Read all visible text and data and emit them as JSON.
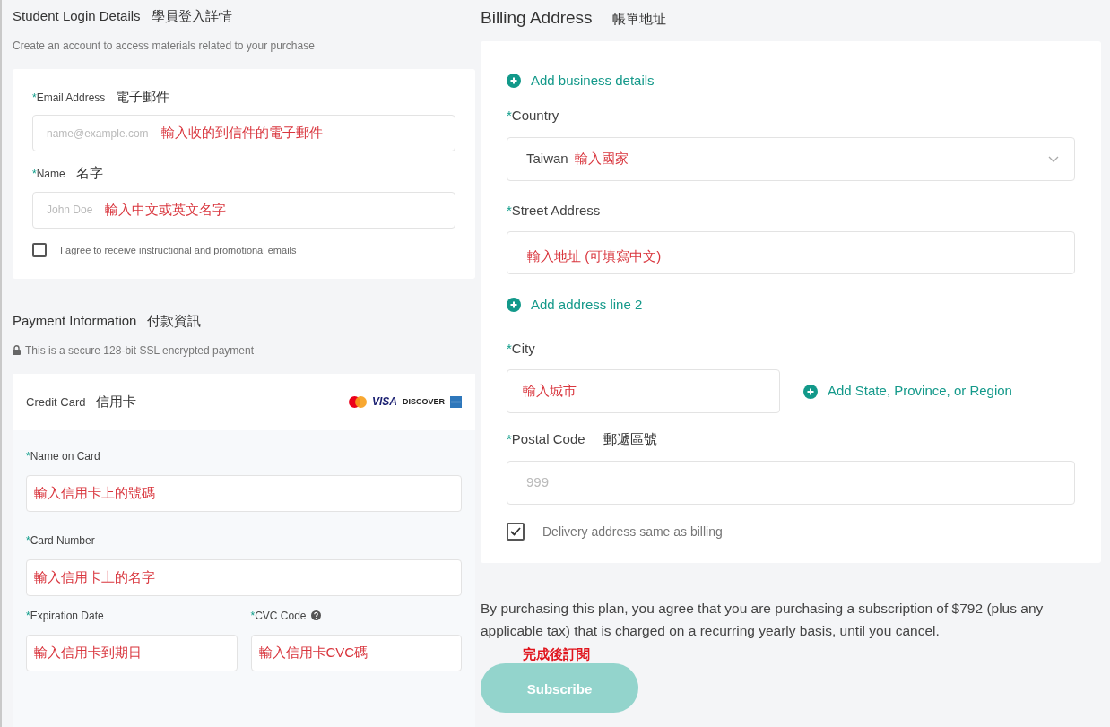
{
  "student_login": {
    "title": "Student Login Details",
    "title_zh": "學員登入詳情",
    "subtitle": "Create an account to access materials related to your purchase",
    "fields": [
      {
        "required": "*",
        "label": "Email Address",
        "label_zh": "電子郵件",
        "placeholder": "name@example.com",
        "annotation": "輸入收的到信件的電子郵件"
      },
      {
        "required": "*",
        "label": "Name",
        "label_zh": "名字",
        "placeholder": "John Doe",
        "annotation": "輸入中文或英文名字"
      }
    ],
    "consent": {
      "label": "I agree to receive instructional and promotional emails",
      "checked": false
    }
  },
  "payment": {
    "title": "Payment Information",
    "title_zh": "付款資訊",
    "secure_note": "This is a secure 128-bit SSL encrypted payment",
    "card_header": {
      "label": "Credit Card",
      "label_zh": "信用卡"
    },
    "card_brands": [
      {
        "kind": "mastercard"
      },
      {
        "kind": "visa",
        "text": "VISA"
      },
      {
        "kind": "discover",
        "text": "DISCOVER"
      },
      {
        "kind": "amex"
      }
    ],
    "fields": [
      {
        "required": "*",
        "label": "Name on Card",
        "annotation": "輸入信用卡上的號碼"
      },
      {
        "required": "*",
        "label": "Card Number",
        "annotation": "輸入信用卡上的名字"
      }
    ],
    "split_fields": [
      {
        "required": "*",
        "label": "Expiration Date",
        "annotation": "輸入信用卡到期日",
        "help": false
      },
      {
        "required": "*",
        "label": "CVC Code",
        "annotation": "輸入信用卡CVC碼",
        "help": true
      }
    ]
  },
  "billing": {
    "title": "Billing Address",
    "title_zh": "帳單地址",
    "add_business": "Add business details",
    "country": {
      "required": "*",
      "label": "Country",
      "value": "Taiwan",
      "annotation": "輸入國家"
    },
    "street": {
      "required": "*",
      "label": "Street Address",
      "annotation": "輸入地址 (可填寫中文)"
    },
    "add_line2": "Add address line 2",
    "city": {
      "required": "*",
      "label": "City",
      "annotation": "輸入城市"
    },
    "add_region": "Add State, Province, or Region",
    "postal": {
      "required": "*",
      "label": "Postal Code",
      "label_zh": "郵遞區號",
      "placeholder": "999"
    },
    "delivery_same": {
      "label": "Delivery address same as billing",
      "checked": true
    }
  },
  "terms": "By purchasing this plan, you agree that you are purchasing a subscription of $792 (plus any applicable tax) that is charged on a recurring yearly basis, until you cancel.",
  "subscribe": {
    "label": "Subscribe",
    "annotation": "完成後訂閱",
    "disabled": true
  }
}
